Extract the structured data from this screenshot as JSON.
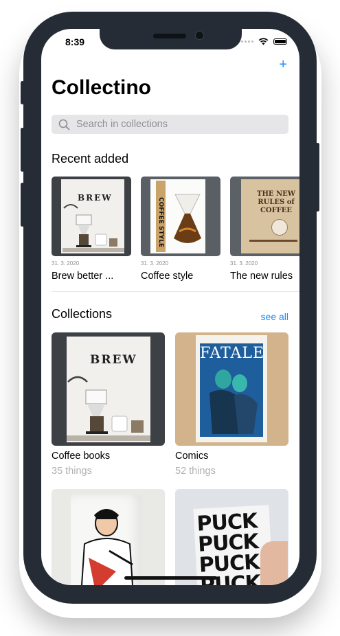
{
  "status_bar": {
    "time": "8:39"
  },
  "nav": {
    "add_symbol": "+"
  },
  "page": {
    "title": "Collectino"
  },
  "search": {
    "placeholder": "Search in collections"
  },
  "recent": {
    "heading": "Recent added",
    "items": [
      {
        "date": "31. 3. 2020",
        "title": "Brew better ...",
        "cover_text": "BREW"
      },
      {
        "date": "31. 3. 2020",
        "title": "Coffee style",
        "cover_text": "COFFEE STYLE"
      },
      {
        "date": "31. 3. 2020",
        "title": "The new rules",
        "cover_text": "THE NEW RULES of COFFEE"
      }
    ]
  },
  "collections": {
    "heading": "Collections",
    "see_all": "see all",
    "items": [
      {
        "name": "Coffee books",
        "count": "35 things",
        "cover_text": "BREW"
      },
      {
        "name": "Comics",
        "count": "52 things",
        "cover_text": "FATALE"
      },
      {
        "name": "",
        "count": ""
      },
      {
        "name": "",
        "count": "",
        "cover_text": "PUCK PUCK PUCK PUCK"
      }
    ]
  },
  "colors": {
    "accent": "#1a8cff",
    "device_frame": "#262c35",
    "search_bg": "#e6e6e8"
  }
}
